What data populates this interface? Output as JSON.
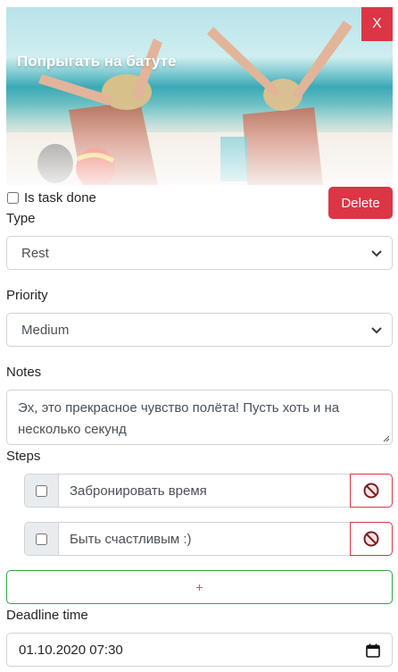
{
  "card": {
    "title": "Попрыгать на батуте",
    "close_label": "X",
    "done_label": "Is task done",
    "delete_label": "Delete"
  },
  "type": {
    "label": "Type",
    "value": "Rest"
  },
  "priority": {
    "label": "Priority",
    "value": "Medium"
  },
  "notes": {
    "label": "Notes",
    "value": "Эх, это прекрасное чувство полёта! Пусть хоть и на несколько секунд"
  },
  "steps": {
    "label": "Steps",
    "items": [
      {
        "text": "Забронировать время"
      },
      {
        "text": "Быть счастливым :)"
      }
    ],
    "add_label": "+"
  },
  "deadline": {
    "label": "Deadline time",
    "value": "01.10.2020 07:30"
  },
  "colors": {
    "danger": "#dc3545",
    "success": "#28a745",
    "border": "#ced4da"
  }
}
